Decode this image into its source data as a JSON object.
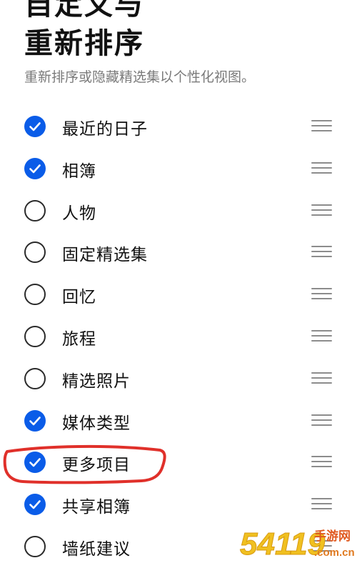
{
  "header": {
    "cut_title": "自定义与",
    "title": "重新排序",
    "subtitle": "重新排序或隐藏精选集以个性化视图。"
  },
  "items": [
    {
      "label": "最近的日子",
      "checked": true
    },
    {
      "label": "相簿",
      "checked": true
    },
    {
      "label": "人物",
      "checked": false
    },
    {
      "label": "固定精选集",
      "checked": false
    },
    {
      "label": "回忆",
      "checked": false
    },
    {
      "label": "旅程",
      "checked": false
    },
    {
      "label": "精选照片",
      "checked": false
    },
    {
      "label": "媒体类型",
      "checked": true
    },
    {
      "label": "更多项目",
      "checked": true,
      "highlighted": true
    },
    {
      "label": "共享相簿",
      "checked": true
    },
    {
      "label": "墙纸建议",
      "checked": false
    }
  ],
  "watermark": {
    "text": "54119",
    "sub_text": "手游网",
    "domain": ".com.cn"
  },
  "colors": {
    "check_on": "#0a5ce8",
    "check_off_border": "#2a2a2a",
    "annotation": "#e0302a",
    "watermark": "#f0c020"
  }
}
